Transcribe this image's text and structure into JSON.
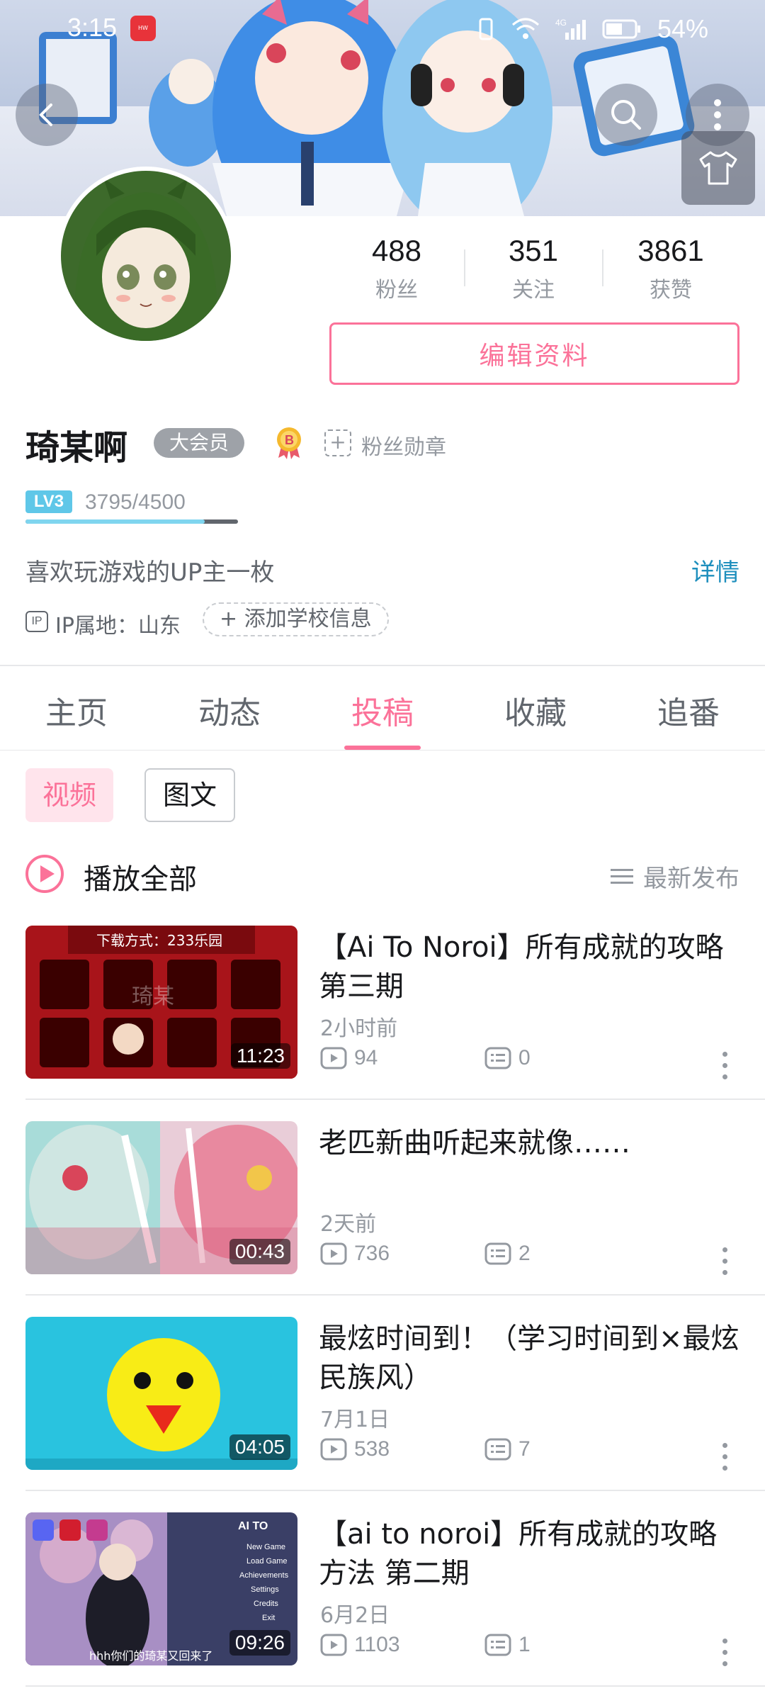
{
  "status_bar": {
    "time": "3:15",
    "battery": "54%",
    "network": "4G"
  },
  "profile": {
    "stats": [
      {
        "value": "488",
        "label": "粉丝"
      },
      {
        "value": "351",
        "label": "关注"
      },
      {
        "value": "3861",
        "label": "获赞"
      }
    ],
    "edit_label": "编辑资料",
    "username": "琦某啊",
    "vip_badge": "大会员",
    "fan_medal": "粉丝勋章",
    "level": "LV3",
    "exp": "3795/4500",
    "exp_progress": 0.843,
    "bio": "喜欢玩游戏的UP主一枚",
    "detail_label": "详情",
    "ip_location": "IP属地：山东",
    "add_school": "添加学校信息"
  },
  "tabs": [
    {
      "label": "主页"
    },
    {
      "label": "动态"
    },
    {
      "label": "投稿",
      "active": true
    },
    {
      "label": "收藏"
    },
    {
      "label": "追番"
    }
  ],
  "content_filters": {
    "video": "视频",
    "article": "图文"
  },
  "play_all": "播放全部",
  "sort": "最新发布",
  "videos": [
    {
      "title": "【Ai To Noroi】所有成就的攻略第三期",
      "time": "2小时前",
      "views": "94",
      "comments": "0",
      "duration": "11:23",
      "thumb_text": "下载方式：233乐园",
      "watermark": "琦某"
    },
    {
      "title": "老匹新曲听起来就像……",
      "time": "2天前",
      "views": "736",
      "comments": "2",
      "duration": "00:43"
    },
    {
      "title": "最炫时间到！（学习时间到×最炫民族风）",
      "time": "7月1日",
      "views": "538",
      "comments": "7",
      "duration": "04:05"
    },
    {
      "title": "【ai to noroi】所有成就的攻略方法 第二期",
      "time": "6月2日",
      "views": "1103",
      "comments": "1",
      "duration": "09:26",
      "subtitle": "hhh你们的琦某又回来了",
      "menu": [
        "New Game",
        "Load Game",
        "Achievements",
        "Settings",
        "Credits",
        "Exit"
      ],
      "game_title": "AI TO"
    }
  ],
  "colors": {
    "accent": "#fb7299",
    "link": "#1e8fbd",
    "vip": "#9ea2a8"
  }
}
